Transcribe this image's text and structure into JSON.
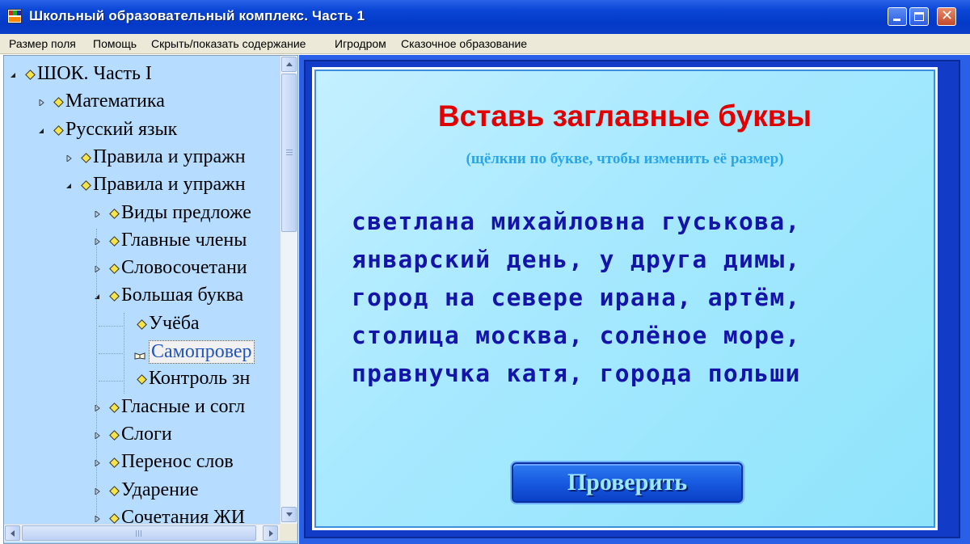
{
  "window": {
    "title": "Школьный образовательный комплекс. Часть 1"
  },
  "menu": [
    "Размер поля",
    "Помощь",
    "Скрыть/показать содержание",
    "Игродром",
    "Сказочное образование"
  ],
  "tree": [
    {
      "label": "ШОК. Часть I",
      "state": "expanded",
      "selected": false
    },
    {
      "label": "Математика",
      "state": "collapsed",
      "selected": false
    },
    {
      "label": "Русский язык",
      "state": "expanded",
      "selected": false
    },
    {
      "label": "Правила и упражн",
      "state": "collapsed",
      "selected": false
    },
    {
      "label": "Правила и упражн",
      "state": "expanded",
      "selected": false
    },
    {
      "label": "Виды предложе",
      "state": "collapsed",
      "selected": false
    },
    {
      "label": "Главные члены",
      "state": "collapsed",
      "selected": false
    },
    {
      "label": "Словосочетани",
      "state": "collapsed",
      "selected": false
    },
    {
      "label": "Большая буква",
      "state": "expanded",
      "selected": false
    },
    {
      "label": "Учёба",
      "state": "leaf",
      "selected": false
    },
    {
      "label": "Самопровер",
      "state": "leaf",
      "selected": true
    },
    {
      "label": "Контроль зн",
      "state": "leaf",
      "selected": false
    },
    {
      "label": "Гласные и согл",
      "state": "collapsed",
      "selected": false
    },
    {
      "label": "Слоги",
      "state": "collapsed",
      "selected": false
    },
    {
      "label": "Перенос слов",
      "state": "collapsed",
      "selected": false
    },
    {
      "label": "Ударение",
      "state": "collapsed",
      "selected": false
    },
    {
      "label": "Сочетания ЖИ",
      "state": "collapsed",
      "selected": false
    }
  ],
  "exercise": {
    "title": "Вставь заглавные буквы",
    "subtitle": "(щёлкни по букве, чтобы изменить её размер)",
    "lines": [
      "светлана михайловна гуськова,",
      "январский день, у друга димы,",
      "город на севере ирана, артём,",
      "столица москва, солёное море,",
      "правнучка катя, города польши"
    ],
    "check_label": "Проверить"
  },
  "colors": {
    "title_red": "#e00000",
    "subtitle_blue": "#2aa6e8",
    "text_navy": "#1414a8",
    "tree_bg": "#b6dcff",
    "panel_border": "#2a5fe8"
  }
}
